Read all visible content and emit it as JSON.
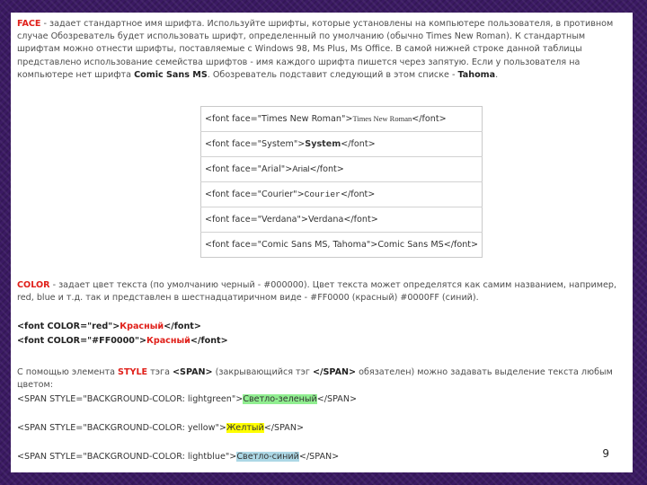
{
  "face_para": {
    "term": "FACE",
    "text": " - задает стандартное имя шрифта. Используйте шрифты, которые установлены на компьютере пользователя, в противном случае Обозреватель будет использовать шрифт, определенный по умолчанию (обычно Times New Roman). К стандартным шрифтам можно отнести шрифты, поставляемые с Windows 98, Ms Plus, Ms Office. В самой нижней строке данной таблицы представлено использование семейства шрифтов - имя каждого шрифта пишется через запятую. Если у пользователя на компьютере нет шрифта ",
    "font1": "Comic Sans MS",
    "text2": ". Обозреватель подставит следующий в этом списке - ",
    "font2": "Tahoma",
    "end": "."
  },
  "font_table": [
    {
      "open": "<font face=\"Times New Roman\">",
      "sample": "Times New Roman",
      "close": "</font>"
    },
    {
      "open": "<font face=\"System\">",
      "sample": "System",
      "close": "</font>"
    },
    {
      "open": "<font face=\"Arial\">",
      "sample": "Arial",
      "close": "</font>"
    },
    {
      "open": "<font face=\"Courier\">",
      "sample": "Courier",
      "close": "</font>"
    },
    {
      "open": "<font face=\"Verdana\">",
      "sample": "Verdana",
      "close": "</font>"
    },
    {
      "open": "<font face=\"Comic Sans MS, Tahoma\">",
      "sample": "Comic Sans MS",
      "close": "</font>"
    }
  ],
  "color_para": {
    "term": "COLOR",
    "text": " - задает цвет текста (по умолчанию черный - #000000). Цвет текста может определятся как самим названием, например, red, blue и т.д. так и представлен в шестнадцатиричном виде - #FF0000 (красный) #0000FF (синий)."
  },
  "color_examples": [
    {
      "open": "<font COLOR=\"red\">",
      "word": "Красный",
      "close": "</font>"
    },
    {
      "open": "<font COLOR=\"#FF0000\">",
      "word": "Красный",
      "close": "</font>"
    }
  ],
  "span_para": {
    "t1": "С помощью элемента ",
    "style": "STYLE",
    "t2": " тэга ",
    "span": "<SPAN>",
    "t3": " (закрывающийся тэг ",
    "span_close": "</SPAN>",
    "t4": " обязателен) можно задавать выделение текста любым цветом:"
  },
  "span_examples": [
    {
      "open": "<SPAN STYLE=\"BACKGROUND-COLOR: lightgreen\">",
      "word": "Светло-зеленый",
      "close": "</SPAN>",
      "color": "#90ee90"
    },
    {
      "open": "<SPAN STYLE=\"BACKGROUND-COLOR: yellow\">",
      "word": "Желтый",
      "close": "</SPAN>",
      "color": "#ffff00"
    },
    {
      "open": "<SPAN STYLE=\"BACKGROUND-COLOR: lightblue\">",
      "word": "Светло-синий",
      "close": "</SPAN>",
      "color": "#add8e6"
    }
  ],
  "page_number": "9"
}
